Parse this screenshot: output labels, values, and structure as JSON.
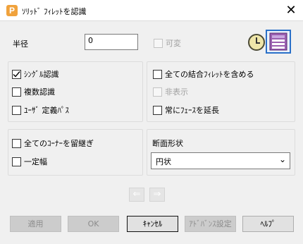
{
  "window": {
    "title": "ｿﾘｯﾄﾞ ﾌｨﾚｯﾄを認識",
    "app_icon_letter": "P",
    "close_glyph": "✕"
  },
  "radius": {
    "label": "半径",
    "value": "0",
    "variable_label": "可変",
    "variable_checked": false
  },
  "recognition": {
    "single": {
      "label": "ｼﾝｸﾞﾙ認識",
      "checked": true
    },
    "multiple": {
      "label": "複数認識",
      "checked": false
    },
    "user_defined_path": {
      "label": "ﾕｰｻﾞ 定義ﾊﾟｽ",
      "checked": false
    }
  },
  "options": {
    "include_all_joined": {
      "label": "全ての結合ﾌｨﾚｯﾄを含める",
      "checked": false
    },
    "hide": {
      "label": "非表示",
      "checked": false
    },
    "always_extend_face": {
      "label": "常にﾌｪｰｽを延長",
      "checked": false
    }
  },
  "corners": {
    "keep_all_corners": {
      "label": "全てのｺｰﾅｰを留継ぎ",
      "checked": false
    },
    "constant_width": {
      "label": "一定幅",
      "checked": false
    }
  },
  "section": {
    "label": "断面形状",
    "value": "円状"
  },
  "nav": {
    "prev_glyph": "⇐",
    "next_glyph": "⇒"
  },
  "buttons": {
    "apply": "適用",
    "ok": "OK",
    "cancel": "ｷｬﾝｾﾙ",
    "advanced": "ｱﾄﾞﾊﾞﾝｽ設定",
    "help": "ﾍﾙﾌﾟ"
  }
}
